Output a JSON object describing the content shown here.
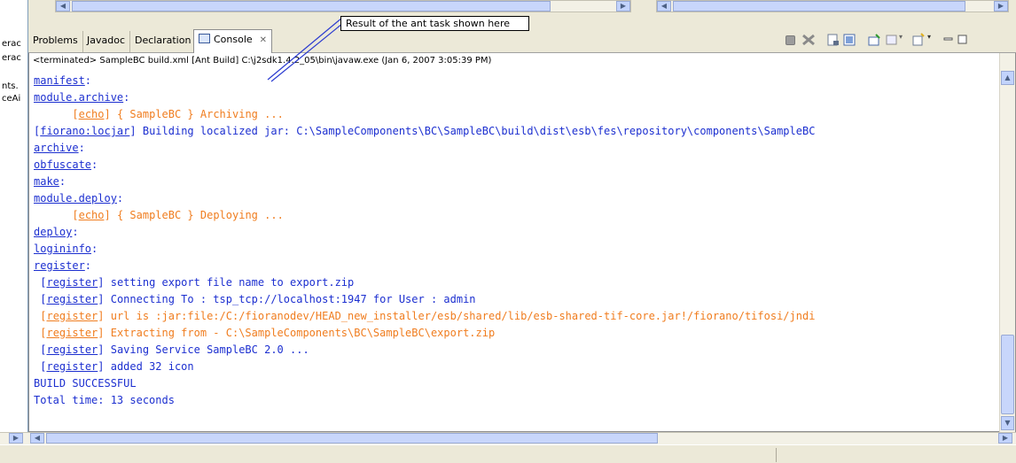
{
  "left_panel": {
    "fragments": [
      "erac",
      "erac",
      "nts.",
      "ceAi"
    ]
  },
  "tabs": [
    {
      "label": "Problems"
    },
    {
      "label": "Javadoc"
    },
    {
      "label": "Declaration"
    },
    {
      "label": "Console",
      "active": true
    }
  ],
  "callout": {
    "text": "Result of the ant task shown here"
  },
  "console": {
    "terminated_line": "<terminated> SampleBC build.xml [Ant Build] C:\\j2sdk1.4.2_05\\bin\\javaw.exe (Jan 6, 2007 3:05:39 PM)",
    "lines": [
      {
        "link": "manifest",
        "rest": ":",
        "color": "blue",
        "indent": ""
      },
      {
        "link": "module.archive",
        "rest": ":",
        "color": "blue",
        "indent": ""
      },
      {
        "prefix": "[",
        "link": "echo",
        "rest": "] { SampleBC } Archiving ...",
        "color": "orange",
        "indent": "      "
      },
      {
        "prefix": "[",
        "link": "fiorano:locjar",
        "rest": "] Building localized jar: C:\\SampleComponents\\BC\\SampleBC\\build\\dist\\esb\\fes\\repository\\components\\SampleBC",
        "color": "blue",
        "indent": ""
      },
      {
        "link": "archive",
        "rest": ":",
        "color": "blue",
        "indent": ""
      },
      {
        "link": "obfuscate",
        "rest": ":",
        "color": "blue",
        "indent": ""
      },
      {
        "link": "make",
        "rest": ":",
        "color": "blue",
        "indent": ""
      },
      {
        "link": "module.deploy",
        "rest": ":",
        "color": "blue",
        "indent": ""
      },
      {
        "prefix": "[",
        "link": "echo",
        "rest": "] { SampleBC } Deploying ...",
        "color": "orange",
        "indent": "      "
      },
      {
        "link": "deploy",
        "rest": ":",
        "color": "blue",
        "indent": ""
      },
      {
        "link": "logininfo",
        "rest": ":",
        "color": "blue",
        "indent": ""
      },
      {
        "link": "register",
        "rest": ":",
        "color": "blue",
        "indent": ""
      },
      {
        "prefix": "[",
        "link": "register",
        "rest": "] setting export file name to export.zip",
        "color": "blue",
        "indent": " "
      },
      {
        "prefix": "[",
        "link": "register",
        "rest": "] Connecting To : tsp_tcp://localhost:1947 for User : admin",
        "color": "blue",
        "indent": " "
      },
      {
        "prefix": "[",
        "link": "register",
        "rest": "] url is :jar:file:/C:/fioranodev/HEAD_new_installer/esb/shared/lib/esb-shared-tif-core.jar!/fiorano/tifosi/jndi",
        "color": "orange",
        "indent": " "
      },
      {
        "prefix": "[",
        "link": "register",
        "rest": "] Extracting from - C:\\SampleComponents\\BC\\SampleBC\\export.zip",
        "color": "orange",
        "indent": " "
      },
      {
        "prefix": "[",
        "link": "register",
        "rest": "] Saving Service SampleBC 2.0 ...",
        "color": "blue",
        "indent": " "
      },
      {
        "prefix": "[",
        "link": "register",
        "rest": "] added 32 icon",
        "color": "blue",
        "indent": " "
      },
      {
        "link": "",
        "rest": "BUILD SUCCESSFUL",
        "color": "blue",
        "indent": ""
      },
      {
        "link": "",
        "rest": "Total time: 13 seconds",
        "color": "blue",
        "indent": ""
      }
    ]
  },
  "colors": {
    "blue_text": "#1c2fd0",
    "orange_text": "#f07d1f"
  },
  "icons": [
    "console-icon",
    "close-icon",
    "terminate-icon",
    "remove-all-icon",
    "clear-console-icon",
    "scroll-lock-icon",
    "pin-console-icon",
    "display-console-icon",
    "open-console-icon",
    "minimize-icon",
    "maximize-icon"
  ]
}
